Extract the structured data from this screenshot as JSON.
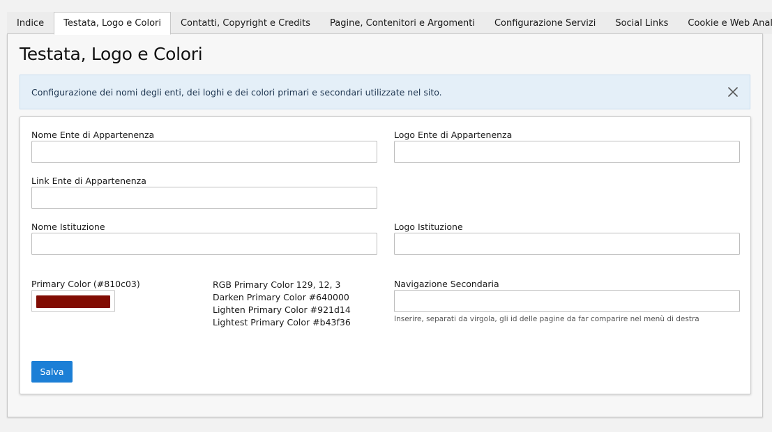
{
  "tabs": [
    {
      "label": "Indice",
      "active": false
    },
    {
      "label": "Testata, Logo e Colori",
      "active": true
    },
    {
      "label": "Contatti, Copyright e Credits",
      "active": false
    },
    {
      "label": "Pagine, Contenitori e Argomenti",
      "active": false
    },
    {
      "label": "Configurazione Servizi",
      "active": false
    },
    {
      "label": "Social Links",
      "active": false
    },
    {
      "label": "Cookie e Web Analytics",
      "active": false
    }
  ],
  "page_title": "Testata, Logo e Colori",
  "alert": {
    "text": "Configurazione dei nomi degli enti, dei loghi e dei colori primari e secondari utilizzate nel sito.",
    "close_icon": "close-icon"
  },
  "form": {
    "nome_ente": {
      "label": "Nome Ente di Appartenenza",
      "value": ""
    },
    "logo_ente": {
      "label": "Logo Ente di Appartenenza",
      "value": ""
    },
    "link_ente": {
      "label": "Link Ente di Appartenenza",
      "value": ""
    },
    "nome_istituzione": {
      "label": "Nome Istituzione",
      "value": ""
    },
    "logo_istituzione": {
      "label": "Logo Istituzione",
      "value": ""
    },
    "primary_color": {
      "label": "Primary Color (#810c03)",
      "value": "#810c03"
    },
    "rgb_info": {
      "rgb": "RGB Primary Color 129, 12, 3",
      "darken": "Darken Primary Color #640000",
      "lighten": "Lighten Primary Color #921d14",
      "lightest": "Lightest Primary Color #b43f36"
    },
    "nav_secondaria": {
      "label": "Navigazione Secondaria",
      "value": "",
      "help": "Inserire, separati da virgola, gli id delle pagine da far comparire nel menù di destra"
    },
    "save_label": "Salva"
  },
  "colors": {
    "accent": "#1c7fd6",
    "alert_bg": "#e4eff8",
    "primary_swatch": "#810c03"
  }
}
